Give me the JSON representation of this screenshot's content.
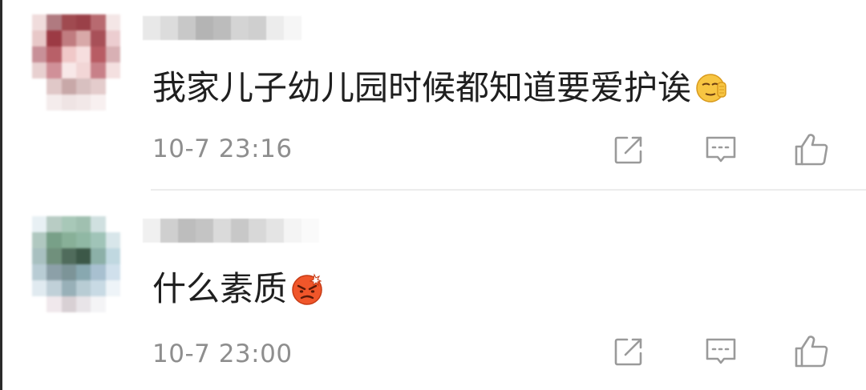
{
  "comments": [
    {
      "text": "我家儿子幼儿园时候都知道要爱护诶",
      "emoji": "smirk-hand-emoji",
      "time": "10-7 23:16",
      "actions": {
        "share_icon": "share-icon",
        "reply_icon": "comment-icon",
        "like_icon": "thumbs-up-icon"
      }
    },
    {
      "text": "什么素质",
      "emoji": "angry-face-emoji",
      "time": "10-7 23:00",
      "actions": {
        "share_icon": "share-icon",
        "reply_icon": "comment-icon",
        "like_icon": "thumbs-up-icon"
      }
    }
  ],
  "colors": {
    "text": "#1f1f1f",
    "meta": "#8e8e8e",
    "icon": "#9a9a9a",
    "divider": "#ececec"
  }
}
